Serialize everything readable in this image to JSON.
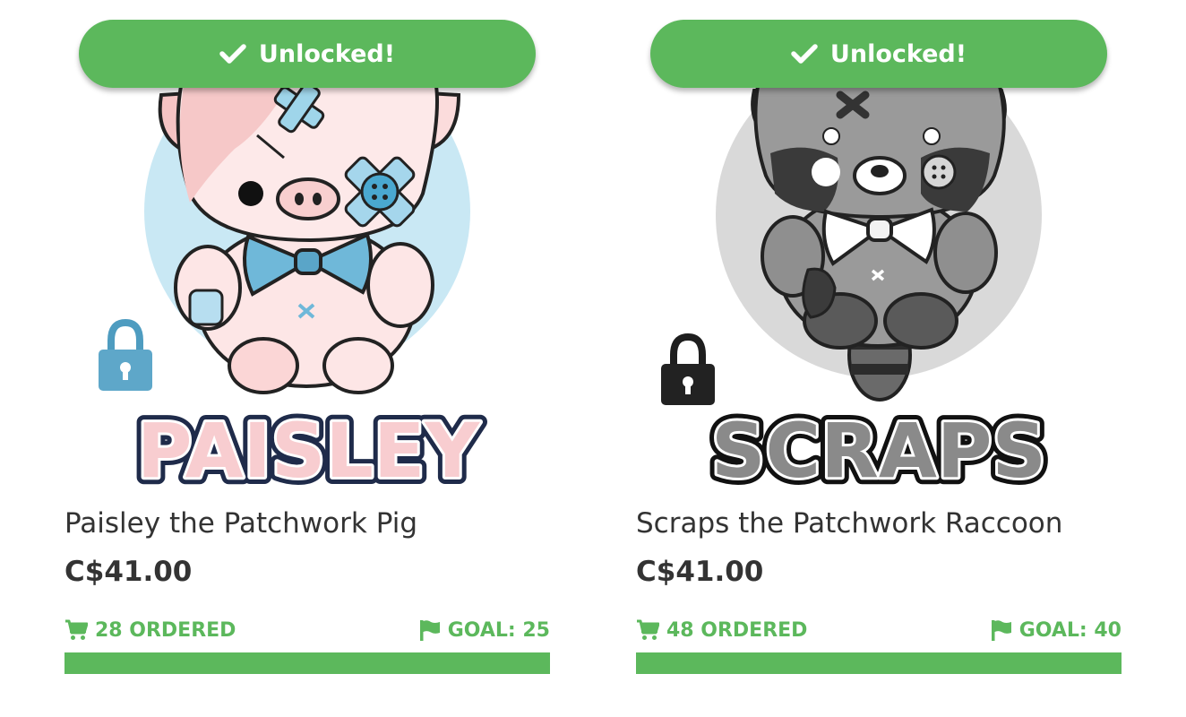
{
  "colors": {
    "accent": "#5cb85c",
    "text": "#333333"
  },
  "products": [
    {
      "unlock_label": "Unlocked!",
      "name": "Paisley the Patchwork Pig",
      "logo_text": "PAISLEY",
      "price": "C$41.00",
      "ordered_label": "28 ORDERED",
      "goal_label": "GOAL: 25",
      "ordered": 28,
      "goal": 25,
      "progress_percent": 100,
      "lock_icon": "lock-icon-blue"
    },
    {
      "unlock_label": "Unlocked!",
      "name": "Scraps the Patchwork Raccoon",
      "logo_text": "SCRAPS",
      "price": "C$41.00",
      "ordered_label": "48 ORDERED",
      "goal_label": "GOAL: 40",
      "ordered": 48,
      "goal": 40,
      "progress_percent": 100,
      "lock_icon": "lock-icon-black"
    }
  ]
}
